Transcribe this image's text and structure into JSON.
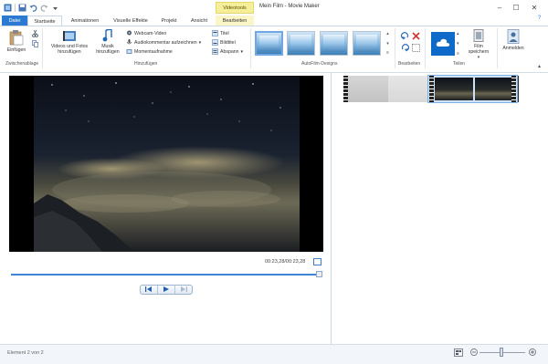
{
  "window": {
    "title": "Mein Film - Movie Maker",
    "context_tab_header": "Videotools"
  },
  "tabs": [
    {
      "label": "Datei"
    },
    {
      "label": "Startseite"
    },
    {
      "label": "Animationen"
    },
    {
      "label": "Visuelle Effekte"
    },
    {
      "label": "Projekt"
    },
    {
      "label": "Ansicht"
    },
    {
      "label": "Bearbeiten"
    }
  ],
  "ribbon": {
    "clipboard": {
      "paste_label": "Einfügen",
      "group_label": "Zwischenablage"
    },
    "add": {
      "videos_photos_label": "Videos und Fotos hinzufügen",
      "music_label": "Musik hinzufügen",
      "webcam_label": "Webcam-Video",
      "narration_label": "Audiokommentar aufzeichnen",
      "snapshot_label": "Momentaufnahme",
      "title_label": "Titel",
      "caption_label": "Bildtitel",
      "credits_label": "Abspann",
      "group_label": "Hinzufügen"
    },
    "themes": {
      "group_label": "AutoFilm-Designs"
    },
    "editing": {
      "group_label": "Bearbeiten"
    },
    "share": {
      "save_movie_label": "Film speichern",
      "group_label": "Teilen"
    },
    "signin_label": "Anmelden"
  },
  "preview": {
    "timecode": "00:23,28/00:23,28",
    "progress": 1.0
  },
  "status": {
    "text": "Element 2 von 2"
  },
  "colors": {
    "accent": "#2b79d0",
    "context_tab": "#f6ef9a"
  }
}
